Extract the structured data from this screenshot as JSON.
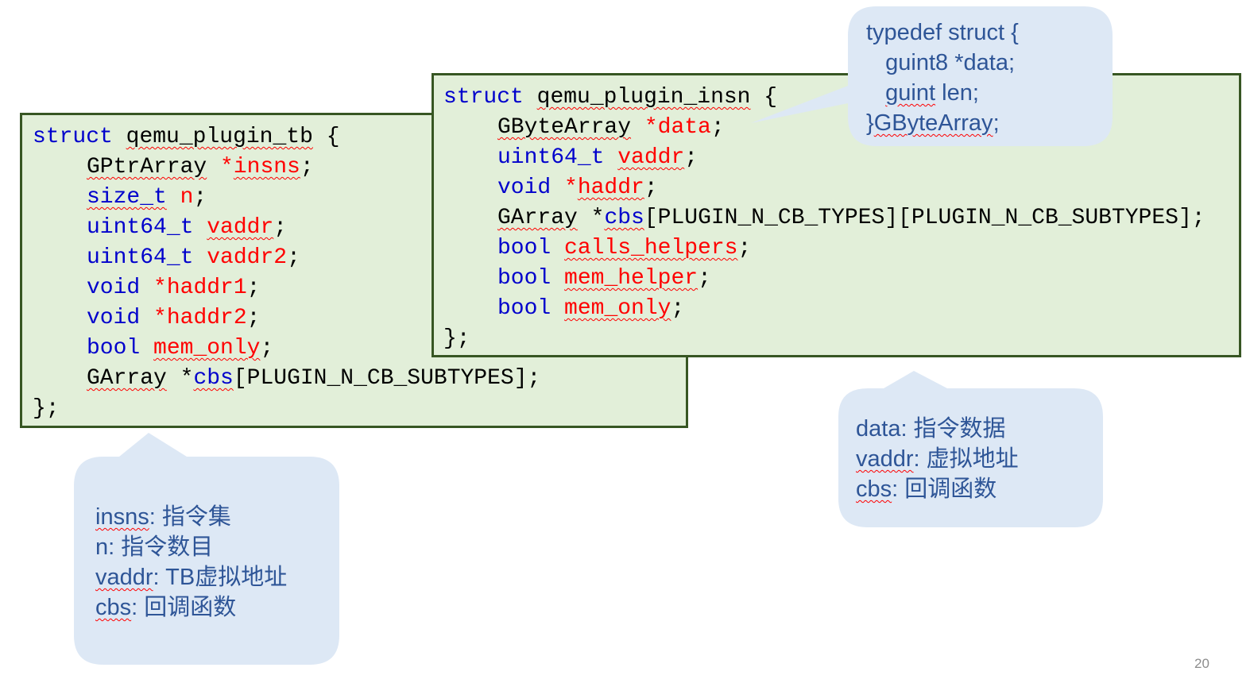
{
  "tb_struct": {
    "lines": [
      {
        "indent": 0,
        "tokens": [
          {
            "text": "struct",
            "style": "kw"
          },
          {
            "text": " ",
            "style": "plain"
          },
          {
            "text": "qemu_plugin_tb",
            "style": "plain",
            "squiggle": true
          },
          {
            "text": " {",
            "style": "plain"
          }
        ]
      },
      {
        "indent": 1,
        "tokens": [
          {
            "text": "GPtrArray",
            "style": "plain",
            "squiggle": true
          },
          {
            "text": " *",
            "style": "var"
          },
          {
            "text": "insns",
            "style": "var",
            "squiggle": true
          },
          {
            "text": ";",
            "style": "plain"
          }
        ]
      },
      {
        "indent": 1,
        "tokens": [
          {
            "text": "size_t",
            "style": "kw",
            "squiggle": true
          },
          {
            "text": " ",
            "style": "plain"
          },
          {
            "text": "n",
            "style": "var"
          },
          {
            "text": ";",
            "style": "plain"
          }
        ]
      },
      {
        "indent": 1,
        "tokens": [
          {
            "text": "uint64_t",
            "style": "kw"
          },
          {
            "text": " ",
            "style": "plain"
          },
          {
            "text": "vaddr",
            "style": "var",
            "squiggle": true
          },
          {
            "text": ";",
            "style": "plain"
          }
        ]
      },
      {
        "indent": 1,
        "tokens": [
          {
            "text": "uint64_t",
            "style": "kw"
          },
          {
            "text": " ",
            "style": "plain"
          },
          {
            "text": "vaddr2",
            "style": "var"
          },
          {
            "text": ";",
            "style": "plain"
          }
        ]
      },
      {
        "indent": 1,
        "tokens": [
          {
            "text": "void",
            "style": "kw"
          },
          {
            "text": " ",
            "style": "plain"
          },
          {
            "text": "*haddr1",
            "style": "var"
          },
          {
            "text": ";",
            "style": "plain"
          }
        ]
      },
      {
        "indent": 1,
        "tokens": [
          {
            "text": "void",
            "style": "kw"
          },
          {
            "text": " ",
            "style": "plain"
          },
          {
            "text": "*haddr2",
            "style": "var"
          },
          {
            "text": ";",
            "style": "plain"
          }
        ]
      },
      {
        "indent": 1,
        "tokens": [
          {
            "text": "bool",
            "style": "kw"
          },
          {
            "text": " ",
            "style": "plain"
          },
          {
            "text": "mem_only",
            "style": "var",
            "squiggle": true
          },
          {
            "text": ";",
            "style": "plain"
          }
        ]
      },
      {
        "indent": 1,
        "tokens": [
          {
            "text": "GArray",
            "style": "plain",
            "squiggle": true
          },
          {
            "text": " *",
            "style": "plain"
          },
          {
            "text": "cbs",
            "style": "kw",
            "squiggle": true
          },
          {
            "text": "[PLUGIN_N_CB_SUBTYPES];",
            "style": "plain"
          }
        ]
      },
      {
        "indent": 0,
        "tokens": [
          {
            "text": "};",
            "style": "plain"
          }
        ]
      }
    ]
  },
  "insn_struct": {
    "lines": [
      {
        "indent": 0,
        "tokens": [
          {
            "text": "struct",
            "style": "kw"
          },
          {
            "text": " ",
            "style": "plain"
          },
          {
            "text": "qemu_plugin_insn",
            "style": "plain",
            "squiggle": true
          },
          {
            "text": " {",
            "style": "plain"
          }
        ]
      },
      {
        "indent": 1,
        "tokens": [
          {
            "text": "GByteArray",
            "style": "plain",
            "squiggle": true
          },
          {
            "text": " ",
            "style": "plain"
          },
          {
            "text": "*data",
            "style": "var"
          },
          {
            "text": ";",
            "style": "plain"
          }
        ]
      },
      {
        "indent": 1,
        "tokens": [
          {
            "text": "uint64_t",
            "style": "kw"
          },
          {
            "text": " ",
            "style": "plain"
          },
          {
            "text": "vaddr",
            "style": "var",
            "squiggle": true
          },
          {
            "text": ";",
            "style": "plain"
          }
        ]
      },
      {
        "indent": 1,
        "tokens": [
          {
            "text": "void",
            "style": "kw"
          },
          {
            "text": " *",
            "style": "var"
          },
          {
            "text": "haddr",
            "style": "var",
            "squiggle": true
          },
          {
            "text": ";",
            "style": "plain"
          }
        ]
      },
      {
        "indent": 1,
        "tokens": [
          {
            "text": "GArray",
            "style": "plain",
            "squiggle": true
          },
          {
            "text": " *",
            "style": "plain"
          },
          {
            "text": "cbs",
            "style": "kw",
            "squiggle": true
          },
          {
            "text": "[PLUGIN_N_CB_TYPES][PLUGIN_N_CB_SUBTYPES];",
            "style": "plain"
          }
        ]
      },
      {
        "indent": 1,
        "tokens": [
          {
            "text": "bool",
            "style": "kw"
          },
          {
            "text": " ",
            "style": "plain"
          },
          {
            "text": "calls_helpers",
            "style": "var",
            "squiggle": true
          },
          {
            "text": ";",
            "style": "plain"
          }
        ]
      },
      {
        "indent": 1,
        "tokens": [
          {
            "text": "bool",
            "style": "kw"
          },
          {
            "text": " ",
            "style": "plain"
          },
          {
            "text": "mem_helper",
            "style": "var",
            "squiggle": true
          },
          {
            "text": ";",
            "style": "plain"
          }
        ]
      },
      {
        "indent": 1,
        "tokens": [
          {
            "text": "bool",
            "style": "kw"
          },
          {
            "text": " ",
            "style": "plain"
          },
          {
            "text": "mem_only",
            "style": "var",
            "squiggle": true
          },
          {
            "text": ";",
            "style": "plain"
          }
        ]
      },
      {
        "indent": 0,
        "tokens": [
          {
            "text": "};",
            "style": "plain"
          }
        ]
      }
    ]
  },
  "callout_gbytearray": {
    "lines": [
      [
        {
          "text": "typedef struct {"
        }
      ],
      [
        {
          "text": "   guint8 *data;"
        }
      ],
      [
        {
          "text": "   "
        },
        {
          "text": "guint",
          "squiggle": true
        },
        {
          "text": " len;"
        }
      ],
      [
        {
          "text": "}"
        },
        {
          "text": "GByteArray",
          "squiggle": true
        },
        {
          "text": ";"
        }
      ]
    ]
  },
  "callout_tb": {
    "lines": [
      [
        {
          "text": "insns",
          "squiggle": true
        },
        {
          "text": ": 指令集"
        }
      ],
      [
        {
          "text": "n: 指令数目"
        }
      ],
      [
        {
          "text": "vaddr",
          "squiggle": true
        },
        {
          "text": ": TB虚拟地址"
        }
      ],
      [
        {
          "text": "cbs",
          "squiggle": true
        },
        {
          "text": ": 回调函数"
        }
      ]
    ]
  },
  "callout_insn": {
    "lines": [
      [
        {
          "text": "data: 指令数据"
        }
      ],
      [
        {
          "text": "vaddr",
          "squiggle": true
        },
        {
          "text": ": 虚拟地址"
        }
      ],
      [
        {
          "text": "cbs",
          "squiggle": true
        },
        {
          "text": ": 回调函数"
        }
      ]
    ]
  },
  "colors": {
    "code_background": "#e2efd9",
    "code_border": "#375623",
    "keyword": "#0000cc",
    "variable": "#ff0000",
    "callout_fill": "#dde8f5",
    "callout_text": "#2e5597"
  },
  "page_number": "20"
}
